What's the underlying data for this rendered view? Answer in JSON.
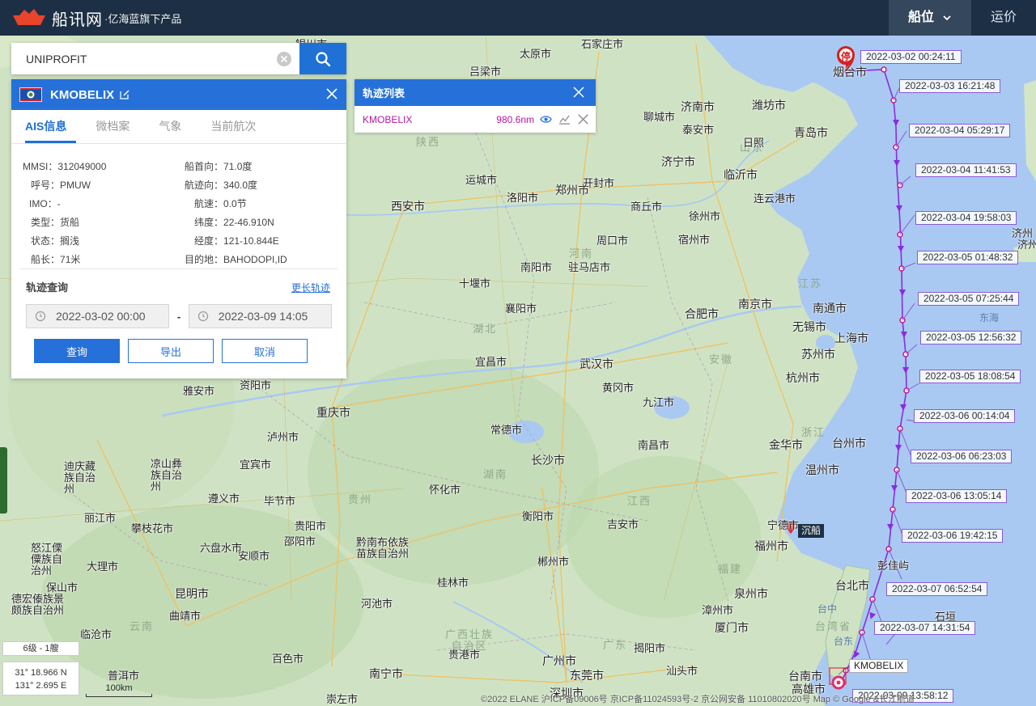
{
  "header": {
    "logo_name": "船讯网",
    "logo_sub": "·亿海蓝旗下产品",
    "nav": [
      {
        "label": "船位"
      },
      {
        "label": "运价"
      }
    ]
  },
  "search": {
    "value": "UNIPROFIT"
  },
  "ship_panel": {
    "name": "KMOBELIX",
    "tabs": [
      {
        "label": "AIS信息"
      },
      {
        "label": "微档案"
      },
      {
        "label": "气象"
      },
      {
        "label": "当前航次"
      }
    ],
    "ais": {
      "mmsi_label": "MMSI：",
      "mmsi": "312049000",
      "callsign_label": "呼号：",
      "callsign": "PMUW",
      "imo_label": "IMO：",
      "imo": "-",
      "type_label": "类型：",
      "type": "货船",
      "status_label": "状态：",
      "status": "搁浅",
      "length_label": "船长：",
      "length": "71米",
      "heading_label": "船首向：",
      "heading": "71.0度",
      "course_label": "航迹向：",
      "course": "340.0度",
      "speed_label": "航速：",
      "speed": "0.0节",
      "lat_label": "纬度：",
      "lat": "22-46.910N",
      "lon_label": "经度：",
      "lon": "121-10.844E",
      "dest_label": "目的地：",
      "dest": "BAHODOPI,ID"
    },
    "track": {
      "title": "轨迹查询",
      "more": "更长轨迹",
      "start": "2022-03-02 00:00",
      "end": "2022-03-09 14:05",
      "dash": "-",
      "query": "查询",
      "export": "导出",
      "cancel": "取消"
    }
  },
  "track_list": {
    "title": "轨迹列表",
    "ship": "KMOBELIX",
    "distance": "980.6nm"
  },
  "track_labels": [
    "2022-03-02 00:24:11",
    "2022-03-03 16:21:48",
    "2022-03-04 05:29:17",
    "2022-03-04 11:41:53",
    "2022-03-04 19:58:03",
    "2022-03-05 01:48:32",
    "2022-03-05 07:25:44",
    "2022-03-05 12:56:32",
    "2022-03-05 18:08:54",
    "2022-03-06 00:14:04",
    "2022-03-06 06:23:03",
    "2022-03-06 13:05:14",
    "2022-03-06 19:42:15",
    "2022-03-07 06:52:54",
    "2022-03-07 14:31:54",
    "2022-03-09 13:58:12"
  ],
  "map_labels": {
    "cities": [
      "石家庄市",
      "太原市",
      "济南市",
      "潍坊市",
      "青岛市",
      "聊城市",
      "泰安市",
      "济宁市",
      "临沂市",
      "连云港市",
      "郑州市",
      "开封市",
      "商丘市",
      "徐州市",
      "宿州市",
      "运城市",
      "洛阳市",
      "西安市",
      "周口市",
      "南阳市",
      "驻马店市",
      "十堰市",
      "襄阳市",
      "合肥市",
      "南京市",
      "南通市",
      "无锡市",
      "上海市",
      "苏州市",
      "宜昌市",
      "武汉市",
      "黄冈市",
      "杭州市",
      "重庆市",
      "九江市",
      "常德市",
      "南昌市",
      "金华市",
      "台州市",
      "长沙市",
      "温州市",
      "泸州市",
      "怀化市",
      "衡阳市",
      "吉安市",
      "宁德市",
      "福州市",
      "遵义市",
      "毕节市",
      "贵阳市",
      "邵阳市",
      "昆明市",
      "曲靖市",
      "桂林市",
      "郴州市",
      "泉州市",
      "漳州市",
      "厦门市",
      "揭阳市",
      "汕头市",
      "广州市",
      "东莞市",
      "深圳市",
      "南宁市",
      "台北市",
      "台南市",
      "高雄市",
      "彭佳屿",
      "烟台市",
      "资阳市",
      "雅安市",
      "宜宾市",
      "丽江市",
      "攀枝花市",
      "大理市",
      "保山市",
      "临沧市",
      "普洱市",
      "河池市",
      "贵港市",
      "崇左市",
      "百色市",
      "安顺市",
      "六盘水市"
    ],
    "provinces": [
      "山东",
      "河南",
      "湖北",
      "安徽",
      "江苏",
      "浙江",
      "湖南",
      "江西",
      "福建",
      "广东",
      "贵州",
      "云南",
      "陕西",
      "广西壮族自治区",
      "台湾省"
    ],
    "places": [
      "吕梁市",
      "银川市",
      "黔南布依族苗族自治州",
      "德宏傣族景颇族自治州",
      "怒江傈僳族自治州",
      "迪庆藏族自治州",
      "凉山彝族自治州",
      "石垣",
      "台东",
      "台中",
      "济州",
      "济州道",
      "东海",
      "日照"
    ]
  },
  "markers": {
    "stop": "停",
    "sunk": "沉船",
    "ship_label": "KMOBELIX"
  },
  "map_info": {
    "zoom": "6级 - 1艘",
    "lat": "31° 18.966 N",
    "lon": "131° 2.695 E",
    "scale": "100km",
    "copyright": "©2022 ELANE  沪ICP备09006号  京ICP备11024593号-2  京公网安备 11010802020号  Map © Google &长江航道"
  },
  "colors": {
    "header": "#1d2f44",
    "accent": "#2671d9",
    "track": "#8a2be2",
    "track_label_border": "#8a5bd6"
  }
}
